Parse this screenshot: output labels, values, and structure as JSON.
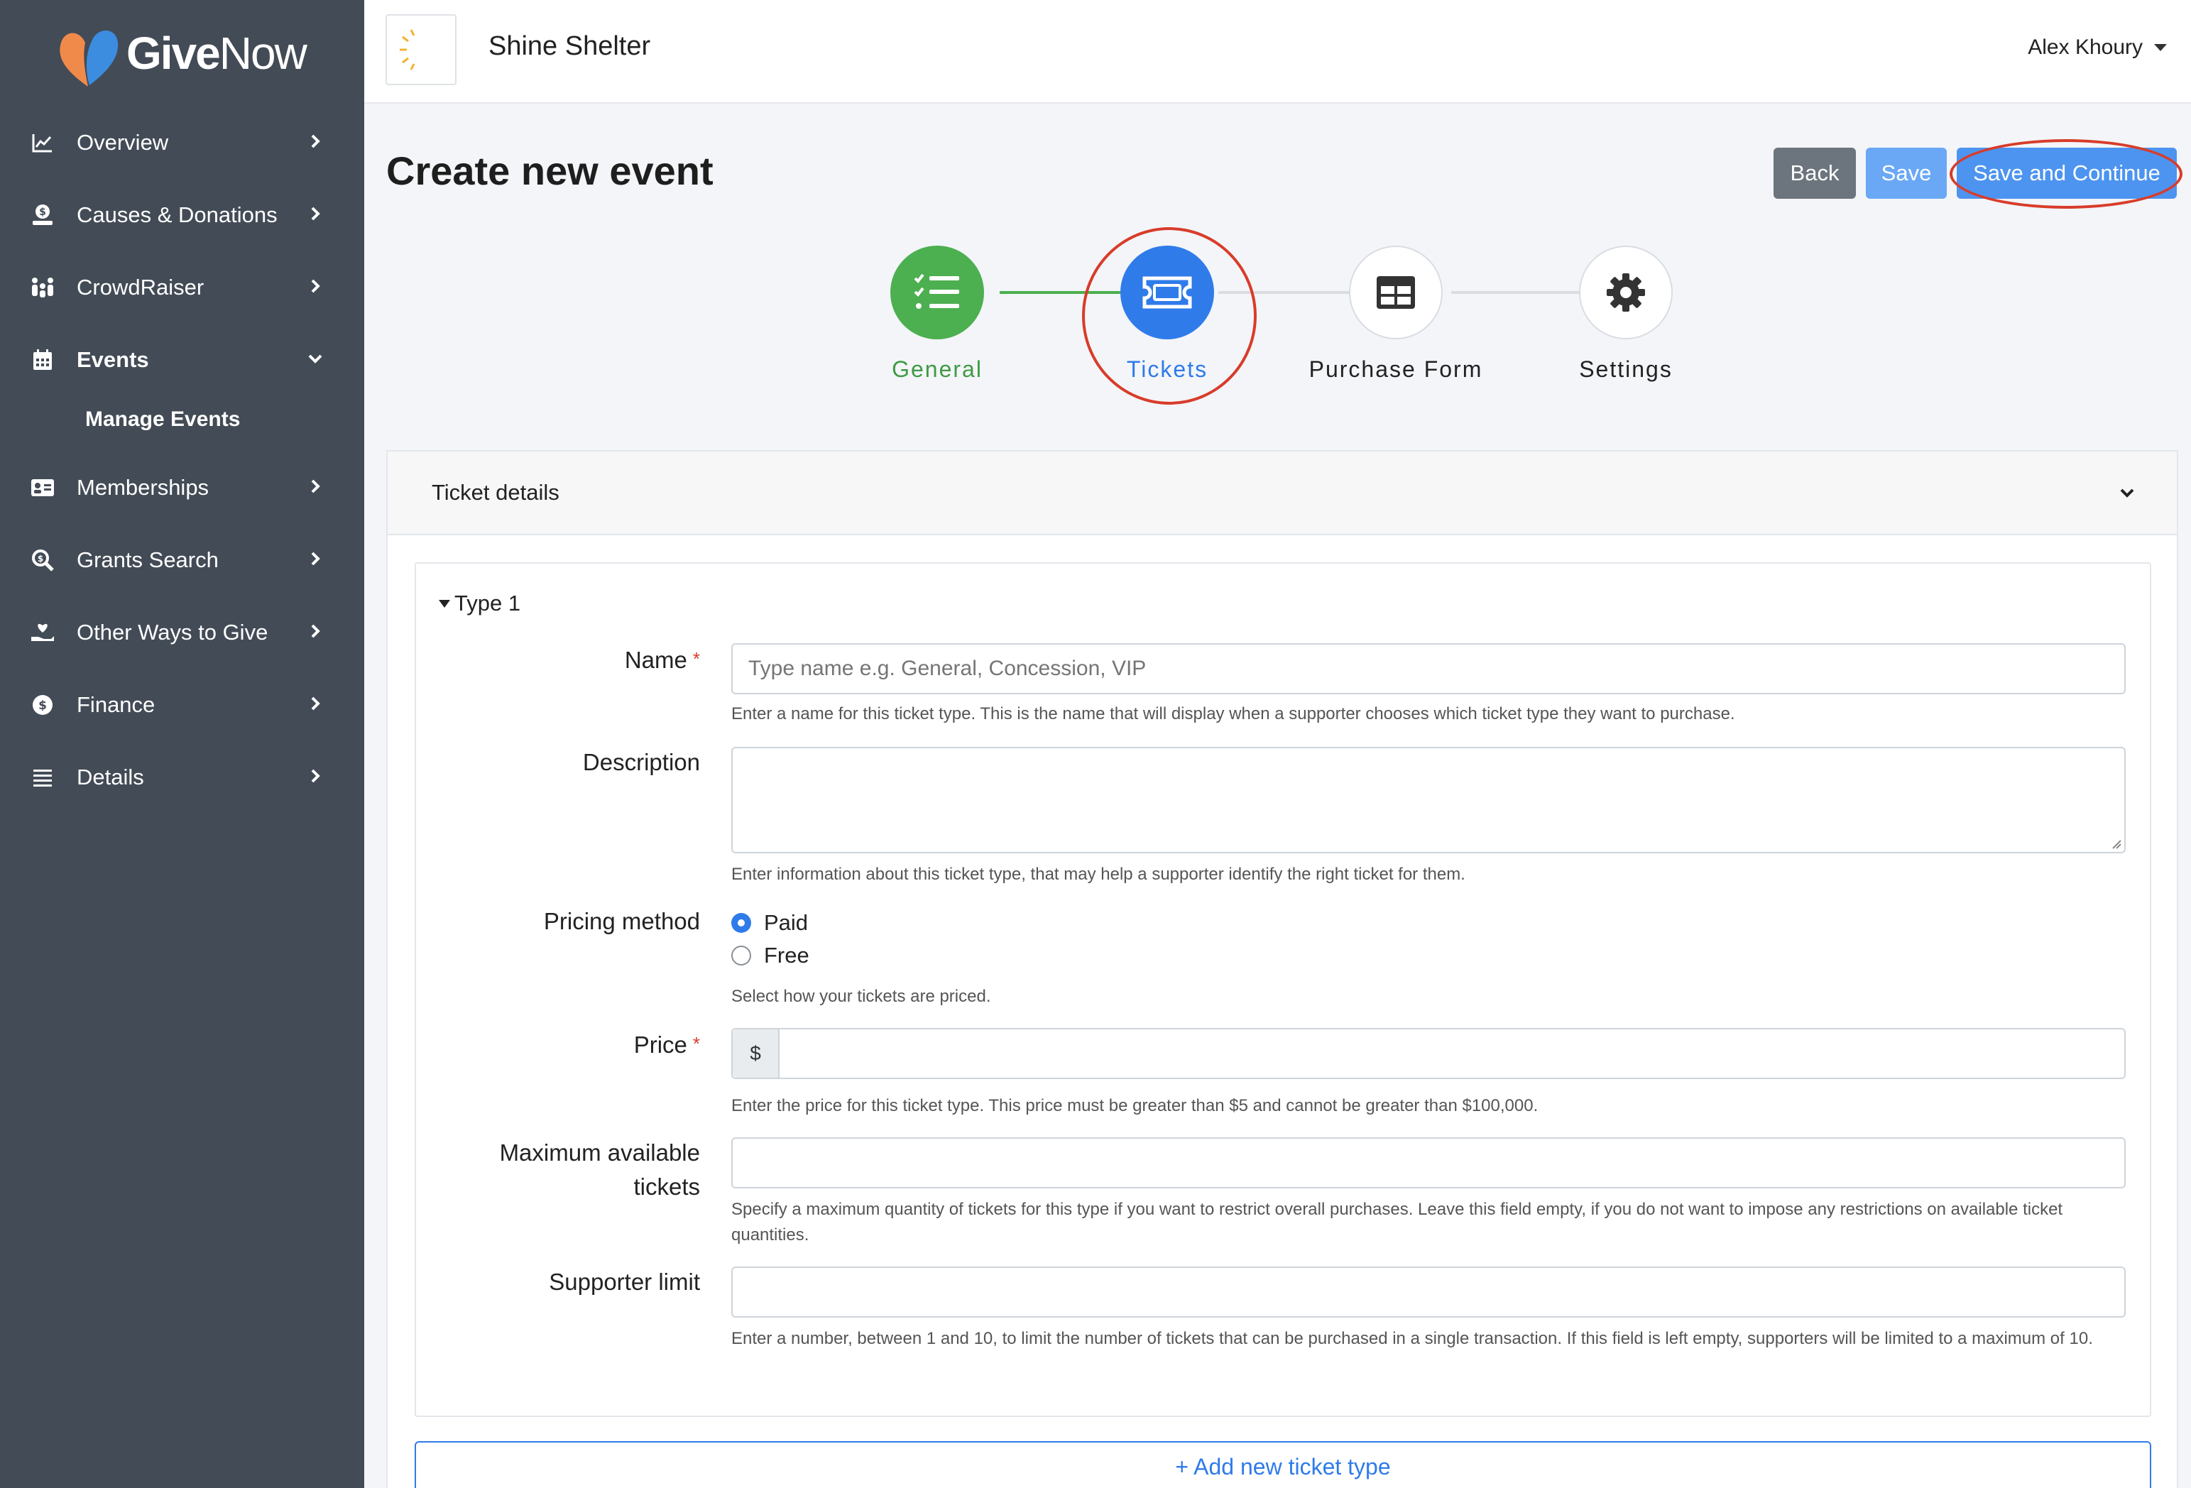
{
  "brand": {
    "name_bold": "Give",
    "name_thin": "Now"
  },
  "sidebar": {
    "items": [
      {
        "label": "Overview",
        "icon": "chart-line-icon"
      },
      {
        "label": "Causes & Donations",
        "icon": "donation-icon"
      },
      {
        "label": "CrowdRaiser",
        "icon": "crowd-icon"
      },
      {
        "label": "Events",
        "icon": "calendar-icon",
        "expanded": true
      },
      {
        "label": "Memberships",
        "icon": "id-card-icon"
      },
      {
        "label": "Grants Search",
        "icon": "search-dollar-icon"
      },
      {
        "label": "Other Ways to Give",
        "icon": "hand-heart-icon"
      },
      {
        "label": "Finance",
        "icon": "coin-icon"
      },
      {
        "label": "Details",
        "icon": "list-icon"
      }
    ],
    "sub_item": "Manage Events"
  },
  "topbar": {
    "org_name": "Shine Shelter",
    "user_name": "Alex Khoury"
  },
  "page": {
    "title": "Create new event",
    "buttons": {
      "back": "Back",
      "save": "Save",
      "save_continue": "Save and Continue"
    }
  },
  "steps": [
    {
      "label": "General",
      "state": "done",
      "icon": "checklist-icon"
    },
    {
      "label": "Tickets",
      "state": "active",
      "icon": "ticket-icon"
    },
    {
      "label": "Purchase Form",
      "state": "pending",
      "icon": "table-icon"
    },
    {
      "label": "Settings",
      "state": "pending",
      "icon": "gear-icon"
    }
  ],
  "colors": {
    "sidebar": "#434b56",
    "primary": "#2f7bea",
    "success": "#4caf50",
    "highlight": "#d83c2a"
  },
  "card": {
    "title": "Ticket details",
    "type_title": "Type 1",
    "fields": {
      "name": {
        "label": "Name",
        "placeholder": "Type name e.g. General, Concession, VIP",
        "help": "Enter a name for this ticket type. This is the name that will display when a supporter chooses which ticket type they want to purchase."
      },
      "description": {
        "label": "Description",
        "help": "Enter information about this ticket type, that may help a supporter identify the right ticket for them."
      },
      "pricing": {
        "label": "Pricing method",
        "options": [
          "Paid",
          "Free"
        ],
        "selected": "Paid",
        "help": "Select how your tickets are priced."
      },
      "price": {
        "label": "Price",
        "prefix": "$",
        "help": "Enter the price for this ticket type. This price must be greater than $5 and cannot be greater than $100,000."
      },
      "max_tickets": {
        "label_line1": "Maximum available",
        "label_line2": "tickets",
        "help": "Specify a maximum quantity of tickets for this type if you want to restrict overall purchases. Leave this field empty, if you do not want to impose any restrictions on available ticket quantities."
      },
      "supporter_limit": {
        "label": "Supporter limit",
        "help": "Enter a number, between 1 and 10, to limit the number of tickets that can be purchased in a single transaction. If this field is left empty, supporters will be limited to a maximum of 10."
      }
    },
    "add_button": "+ Add new ticket type"
  }
}
